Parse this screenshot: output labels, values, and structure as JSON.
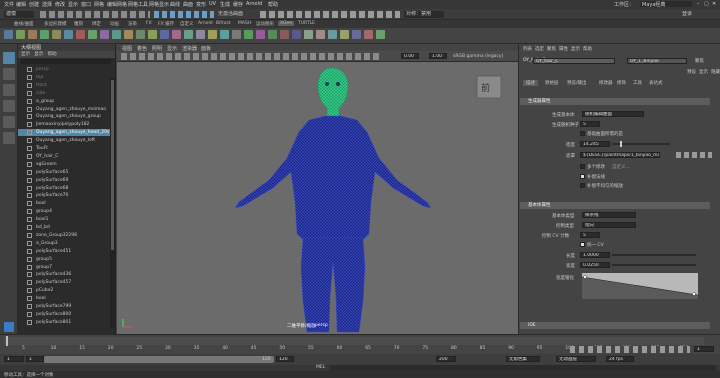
{
  "menubar": {
    "items": [
      "文件",
      "编辑",
      "创建",
      "选择",
      "修改",
      "显示",
      "窗口",
      "网格",
      "编辑网格",
      "网格工具",
      "网格显示",
      "曲线",
      "曲面",
      "变形",
      "UV",
      "生成",
      "缓存",
      "Arnold",
      "帮助"
    ],
    "workspace_label": "工作区：",
    "workspace_value": "Maya经典"
  },
  "statusline": {
    "mode": "建模",
    "no_live": "无激活曲面",
    "symmetry": "对称：禁用",
    "login": "登录"
  },
  "shelf": {
    "tabs": [
      "曲线/曲面",
      "多边形建模",
      "雕刻",
      "绑定",
      "动画",
      "渲染",
      "FX",
      "FX 缓存",
      "自定义",
      "Arnold",
      "Bifrost",
      "MASH",
      "运动图形",
      "XGen",
      "TURTLE"
    ],
    "active_tab": "XGen"
  },
  "outliner": {
    "title": "大纲视图",
    "menu": [
      "显示",
      "显示",
      "帮助"
    ],
    "items": [
      {
        "label": "persp",
        "selected": false,
        "dim": true
      },
      {
        "label": "top",
        "selected": false,
        "dim": true
      },
      {
        "label": "front",
        "selected": false,
        "dim": true
      },
      {
        "label": "side",
        "selected": false,
        "dim": true
      },
      {
        "label": "a_group",
        "selected": false
      },
      {
        "label": "Ouyang_agen_zhouye_meimao",
        "selected": false
      },
      {
        "label": "Ouyang_agen_zhouye_group",
        "selected": false
      },
      {
        "label": "Jiemaoxinyipolypoly182",
        "selected": false
      },
      {
        "label": "Ouyang_agen_zhouye_head_20s",
        "selected": true
      },
      {
        "label": "Ouyang_agen_zhouye_left",
        "selected": false
      },
      {
        "label": "TouFt",
        "selected": false
      },
      {
        "label": "OY_hair_C",
        "selected": false
      },
      {
        "label": "xgGroom",
        "selected": false
      },
      {
        "label": "polySurface65",
        "selected": false
      },
      {
        "label": "polySurface69",
        "selected": false
      },
      {
        "label": "polySurface68",
        "selected": false
      },
      {
        "label": "polySurface70",
        "selected": false
      },
      {
        "label": "bool",
        "selected": false
      },
      {
        "label": "group4",
        "selected": false
      },
      {
        "label": "bool1",
        "selected": false
      },
      {
        "label": "bd_bd",
        "selected": false
      },
      {
        "label": "zone_Group32298",
        "selected": false
      },
      {
        "label": "a_Group3",
        "selected": false
      },
      {
        "label": "polySurface451",
        "selected": false
      },
      {
        "label": "group5",
        "selected": false
      },
      {
        "label": "group7",
        "selected": false
      },
      {
        "label": "polySurface436",
        "selected": false
      },
      {
        "label": "polySurface457",
        "selected": false
      },
      {
        "label": "pCube2",
        "selected": false
      },
      {
        "label": "bool",
        "selected": false
      },
      {
        "label": "polySurface799",
        "selected": false
      },
      {
        "label": "polySurface800",
        "selected": false
      },
      {
        "label": "polySurface801",
        "selected": false
      }
    ]
  },
  "viewport": {
    "menu": [
      "视图",
      "着色",
      "照明",
      "显示",
      "渲染器",
      "面板"
    ],
    "exposure": "0.00",
    "gamma": "1.00",
    "colorspace": "sRGB gamma (legacy)",
    "cube_label": "前",
    "hud_label": "二维平移/缩放",
    "hud_cam": "persp",
    "colors": {
      "body": "#1f2a8a",
      "wire": "#3a4cc6",
      "head": "#31c986",
      "bg": "#6b6b6b"
    }
  },
  "attr": {
    "menu": [
      "列表",
      "选定",
      "聚焦",
      "属性",
      "显示",
      "帮助"
    ],
    "tab1": "OY_hair_C",
    "tab2": "OY_1_Binjiao",
    "focus_btn": "聚焦",
    "preset_btn": "预设",
    "show_btn": "显示",
    "hide_btn": "隐藏",
    "tabs": [
      "描述",
      "原始层",
      "预览/输出",
      "修改器",
      "修饰",
      "工具",
      "表达式"
    ],
    "active_tab": "描述",
    "sec1": "生成器属性",
    "gen_type_label": "生成基本体",
    "gen_type_value": "随机编辑曲面",
    "seed_label": "生成随机种子",
    "seed_value": "5",
    "cb1_label": "基础曲面所需的是",
    "density_label": "密度",
    "density_value": "14.245",
    "mask_label": "遮罩",
    "mask_value": "${DESC}/paintmaps/1_binjiao_mask",
    "cb2_label": "多个修改",
    "cb2_sub": "自定义...",
    "cb3_label": "补偿法线",
    "cb4_label": "补偿不均匀的缩放",
    "sec2": "基本体属性",
    "prim_type_label": "基本体类型",
    "prim_type_value": "样条线",
    "ctrl_label": "控制类型",
    "ctrl_value": "指向",
    "cv_label": "控制 CV 计数",
    "cv_value": "5",
    "cb5_label": "统一 CV",
    "length_label": "长度",
    "length_value": "1.0000",
    "width_label": "宽度",
    "width_value": "0.0250",
    "taper_label": "宽度锥化",
    "sec3": "IDE"
  },
  "timeline": {
    "ticks": [
      "5",
      "10",
      "15",
      "20",
      "25",
      "30",
      "35",
      "40",
      "45",
      "50",
      "55",
      "60",
      "65",
      "70",
      "75",
      "80",
      "85",
      "90",
      "95",
      "100",
      "105",
      "110",
      "115",
      "120"
    ],
    "current": "1"
  },
  "range": {
    "start": "1",
    "start_inner": "1",
    "end_inner": "120",
    "end": "120",
    "end2": "200",
    "char_set": "无角色集",
    "anim_layer": "无动画层",
    "fps": "24 fps"
  },
  "cmd": {
    "mel": "MEL"
  },
  "help": {
    "text": "移动工具：选择一个对象"
  }
}
